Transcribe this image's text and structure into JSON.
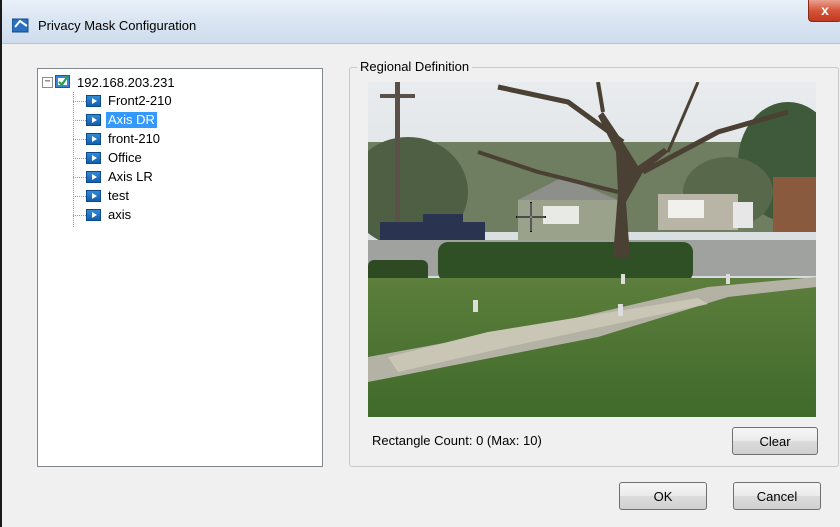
{
  "window": {
    "title": "Privacy Mask Configuration",
    "close_glyph": "x"
  },
  "tree": {
    "root": {
      "label": "192.168.203.231",
      "expander": "−",
      "checked": true,
      "icon": "network-check-icon"
    },
    "items": [
      {
        "label": "Front2-210",
        "selected": false,
        "icon": "camera-icon"
      },
      {
        "label": "Axis DR",
        "selected": true,
        "icon": "camera-icon"
      },
      {
        "label": "front-210",
        "selected": false,
        "icon": "camera-icon"
      },
      {
        "label": "Office",
        "selected": false,
        "icon": "camera-icon"
      },
      {
        "label": "Axis LR",
        "selected": false,
        "icon": "camera-icon"
      },
      {
        "label": "test",
        "selected": false,
        "icon": "camera-icon"
      },
      {
        "label": "axis",
        "selected": false,
        "icon": "camera-icon"
      }
    ]
  },
  "regional": {
    "legend": "Regional Definition",
    "rect_count_label": "Rectangle Count: 0 (Max: 10)",
    "clear_label": "Clear"
  },
  "footer": {
    "ok_label": "OK",
    "cancel_label": "Cancel"
  },
  "colors": {
    "selection": "#3399ff",
    "title_bar": "#dbe6f3",
    "close_button": "#d5553a",
    "dialog_bg": "#f0f0f0"
  }
}
